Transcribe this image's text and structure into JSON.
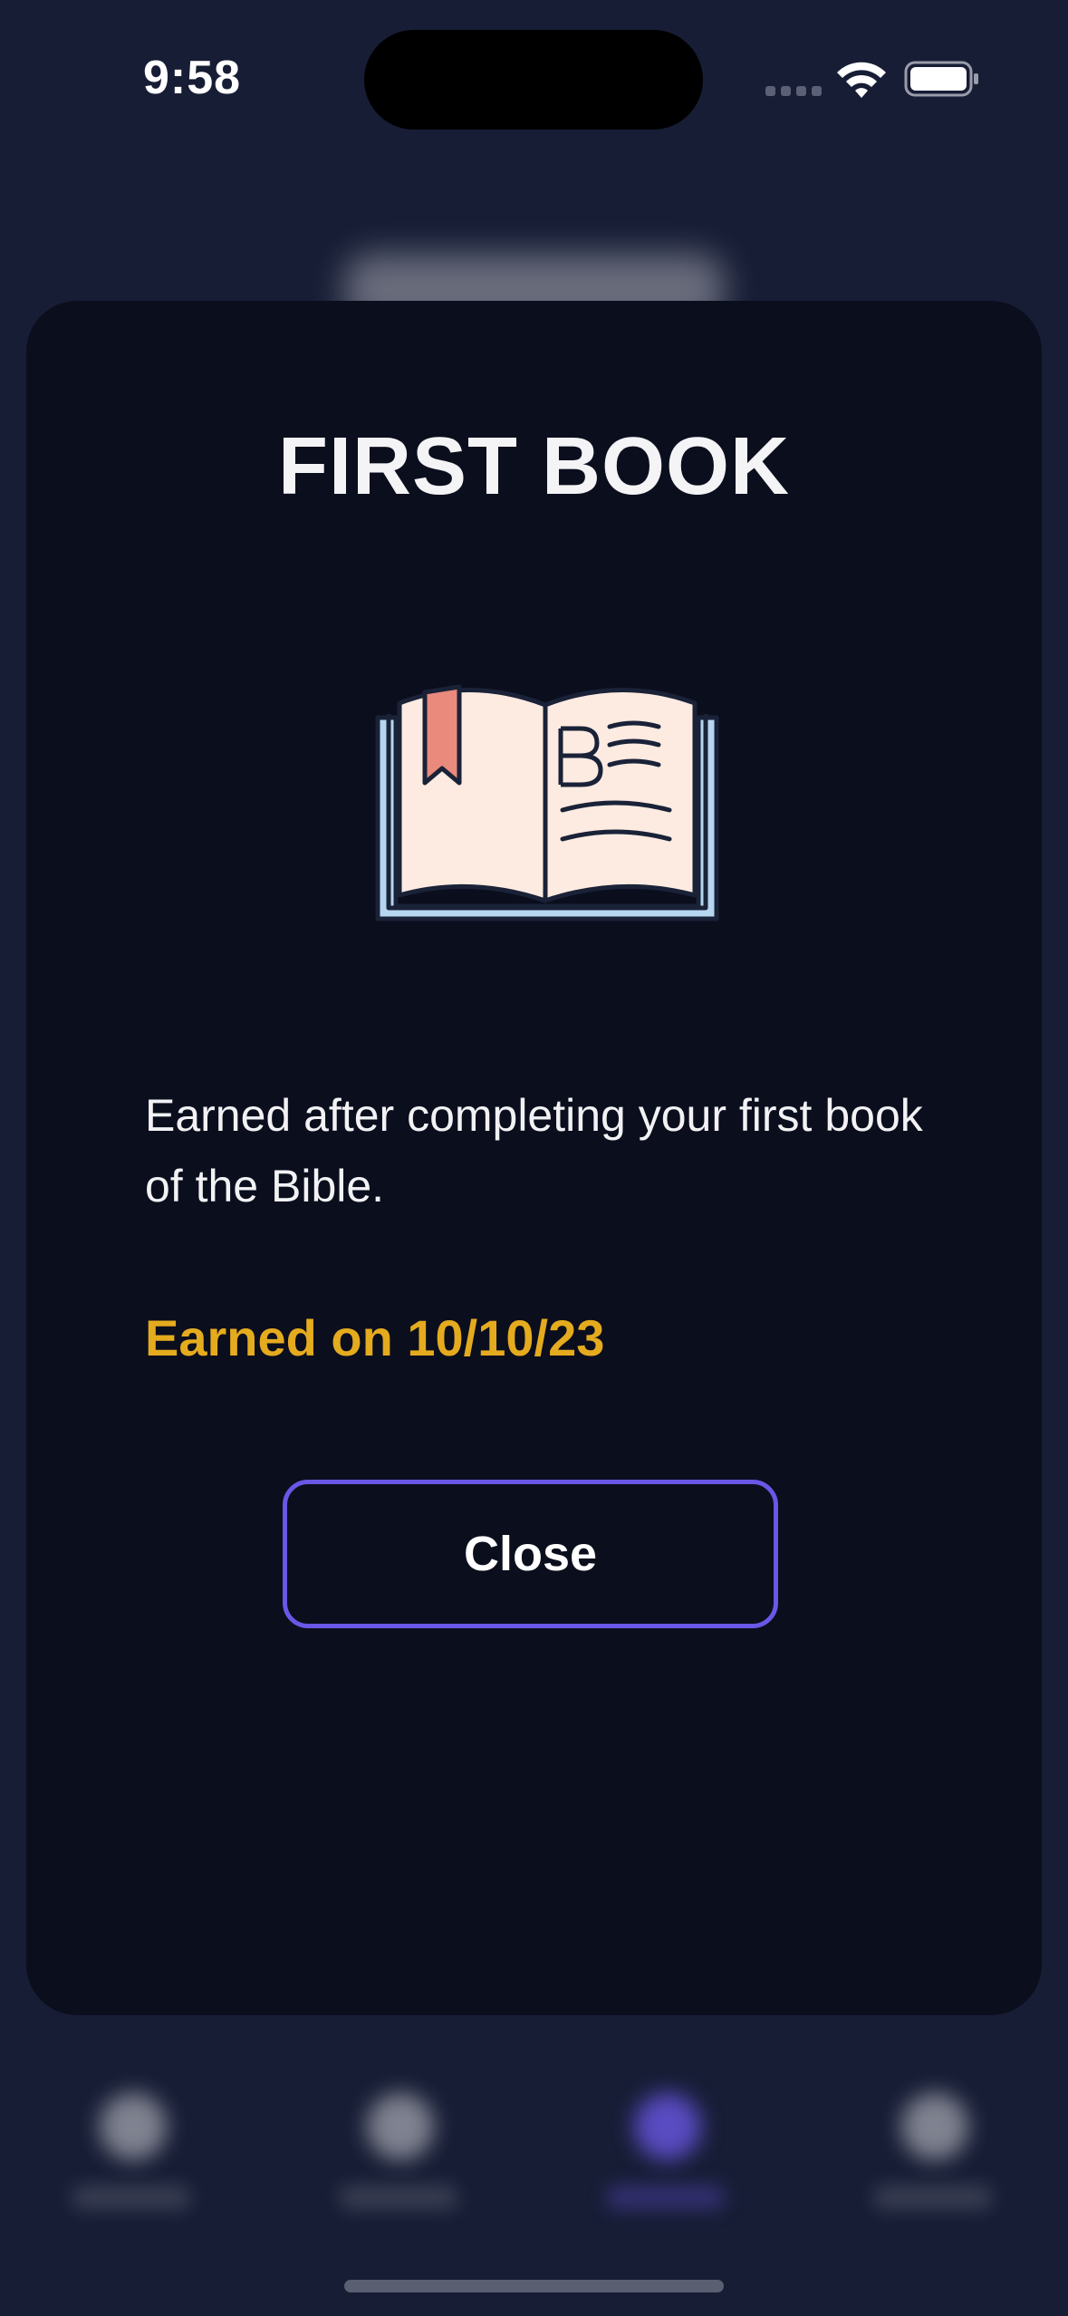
{
  "status_bar": {
    "time": "9:58",
    "wifi_icon": "wifi-icon",
    "battery_icon": "battery-full-icon"
  },
  "modal": {
    "title": "FIRST BOOK",
    "illustration_icon": "open-bible-icon",
    "description": "Earned after completing your first book of the Bible.",
    "earned_date": "Earned on 10/10/23",
    "close_label": "Close"
  },
  "colors": {
    "background": "#171d35",
    "modal_background": "#0b0e1d",
    "accent": "#6a57e6",
    "earned_gold": "#e5ab1f",
    "bookmark": "#ea8a7c",
    "page": "#fdebe1",
    "book_cover": "#b6d6f0"
  }
}
